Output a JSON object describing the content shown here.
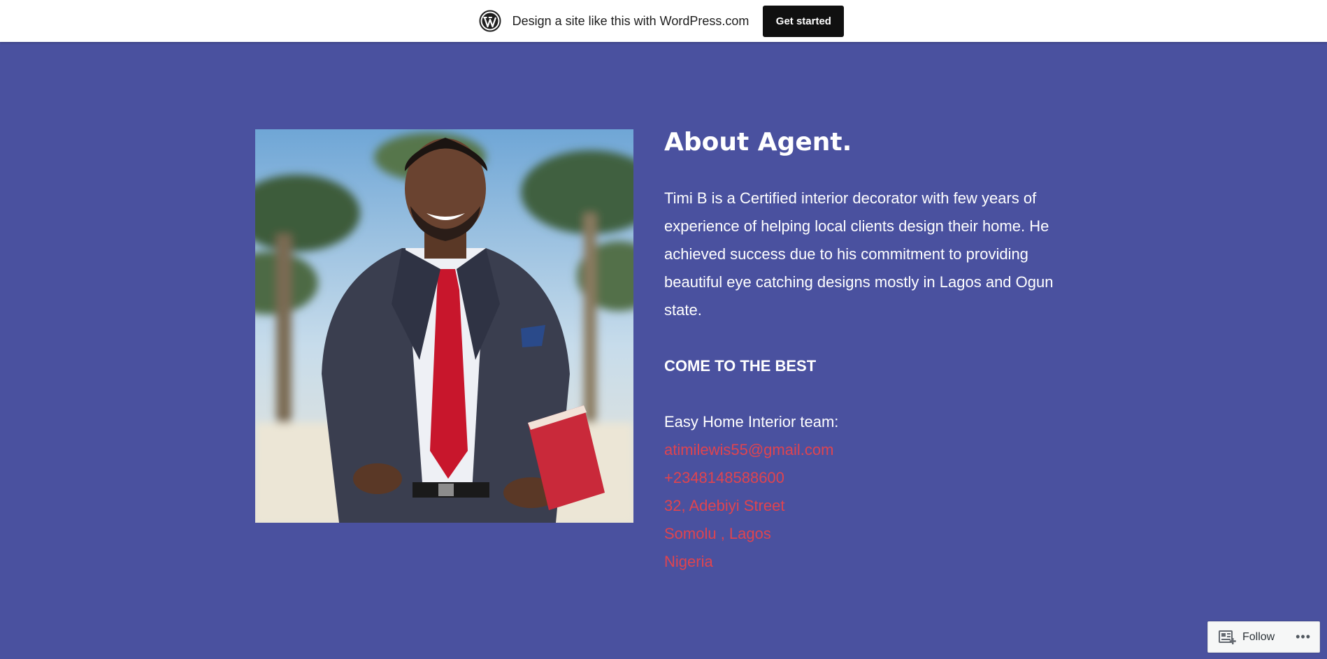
{
  "topbar": {
    "logo_icon": "wordpress-logo-icon",
    "text": "Design a site like this with WordPress.com",
    "button_label": "Get started"
  },
  "about": {
    "photo_icon": "agent-portrait-photo",
    "title": "About Agent.",
    "bio": "Timi B is a Certified interior decorator with few years of experience of helping local clients design their home. He achieved success due to his commitment to providing beautiful eye catching designs mostly in Lagos and Ogun state.",
    "subhead": "COME TO THE BEST",
    "team_label": "Easy Home Interior team:",
    "email": "atimilewis55@gmail.com",
    "phone": "+2348148588600",
    "address_line1": "32, Adebiyi Street",
    "address_line2": "Somolu , Lagos",
    "address_line3": "Nigeria"
  },
  "follow_widget": {
    "label": "Follow",
    "icon": "reader-follow-icon",
    "more_icon": "ellipsis-icon"
  },
  "colors": {
    "background": "#4a519f",
    "link": "#e0444f",
    "topbar_bg": "#ffffff",
    "button_bg": "#101010"
  }
}
